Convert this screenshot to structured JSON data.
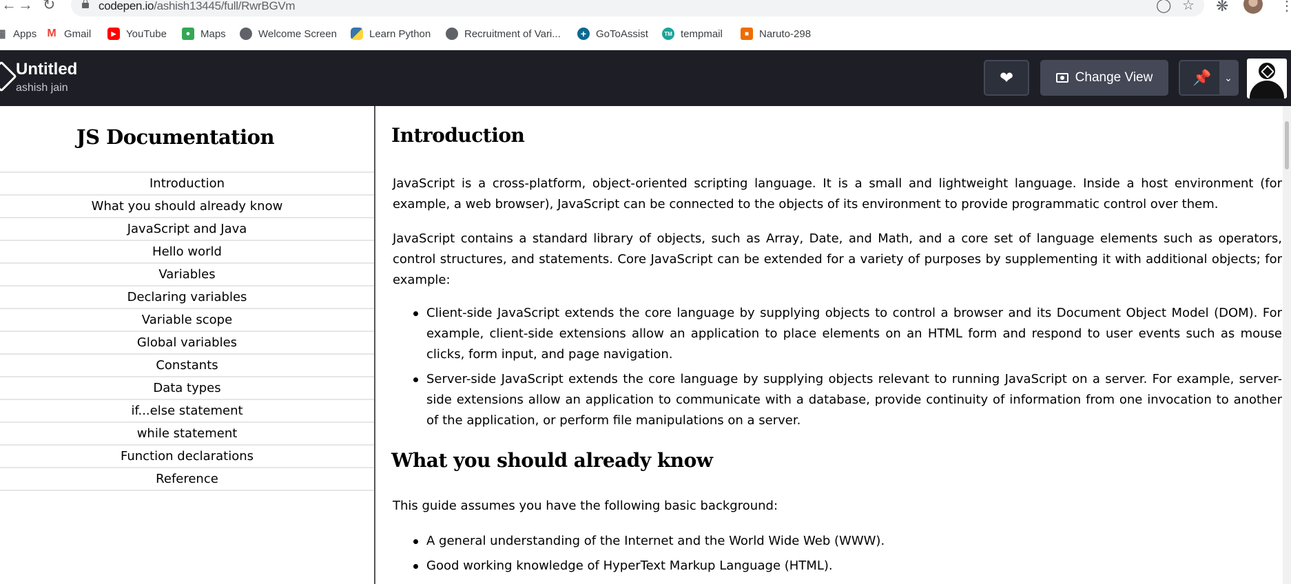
{
  "browser": {
    "url_host": "codepen.io",
    "url_path": "/ashish13445/full/RwrBGVm",
    "bookmarks": [
      {
        "label": "Apps",
        "icon": "apps-grid-icon",
        "color": "#5f6368"
      },
      {
        "label": "Gmail",
        "icon": "gmail-icon",
        "color": "#ea4335"
      },
      {
        "label": "YouTube",
        "icon": "youtube-icon",
        "color": "#ff0000"
      },
      {
        "label": "Maps",
        "icon": "maps-icon",
        "color": "#34a853"
      },
      {
        "label": "Welcome Screen",
        "icon": "globe-icon",
        "color": "#5f6368"
      },
      {
        "label": "Learn Python",
        "icon": "python-icon",
        "color": "#3776ab"
      },
      {
        "label": "Recruitment of Vari...",
        "icon": "globe-icon",
        "color": "#5f6368"
      },
      {
        "label": "GoToAssist",
        "icon": "gotoassist-icon",
        "color": "#0b6a8f"
      },
      {
        "label": "tempmail",
        "icon": "tempmail-icon",
        "color": "#1aa59b"
      },
      {
        "label": "Naruto-298",
        "icon": "naruto-icon",
        "color": "#ef6c00"
      }
    ]
  },
  "codepen": {
    "title": "Untitled",
    "author": "ashish jain",
    "change_view_label": "Change View",
    "accent": "#1e1f26"
  },
  "sidebar": {
    "title": "JS Documentation",
    "links": [
      "Introduction",
      "What you should already know",
      "JavaScript and Java",
      "Hello world",
      "Variables",
      "Declaring variables",
      "Variable scope",
      "Global variables",
      "Constants",
      "Data types",
      "if...else statement",
      "while statement",
      "Function declarations",
      "Reference"
    ]
  },
  "main": {
    "intro": {
      "heading": "Introduction",
      "p1": "JavaScript is a cross-platform, object-oriented scripting language. It is a small and lightweight language. Inside a host environment (for example, a web browser), JavaScript can be connected to the objects of its environment to provide programmatic control over them.",
      "p2": "JavaScript contains a standard library of objects, such as Array, Date, and Math, and a core set of language elements such as operators, control structures, and statements. Core JavaScript can be extended for a variety of purposes by supplementing it with additional objects; for example:",
      "bullets": [
        "Client-side JavaScript extends the core language by supplying objects to control a browser and its Document Object Model (DOM). For example, client-side extensions allow an application to place elements on an HTML form and respond to user events such as mouse clicks, form input, and page navigation.",
        "Server-side JavaScript extends the core language by supplying objects relevant to running JavaScript on a server. For example, server-side extensions allow an application to communicate with a database, provide continuity of information from one invocation to another of the application, or perform file manipulations on a server."
      ]
    },
    "know": {
      "heading": "What you should already know",
      "p1": "This guide assumes you have the following basic background:",
      "bullets": [
        "A general understanding of the Internet and the World Wide Web (WWW).",
        "Good working knowledge of HyperText Markup Language (HTML)."
      ]
    }
  }
}
